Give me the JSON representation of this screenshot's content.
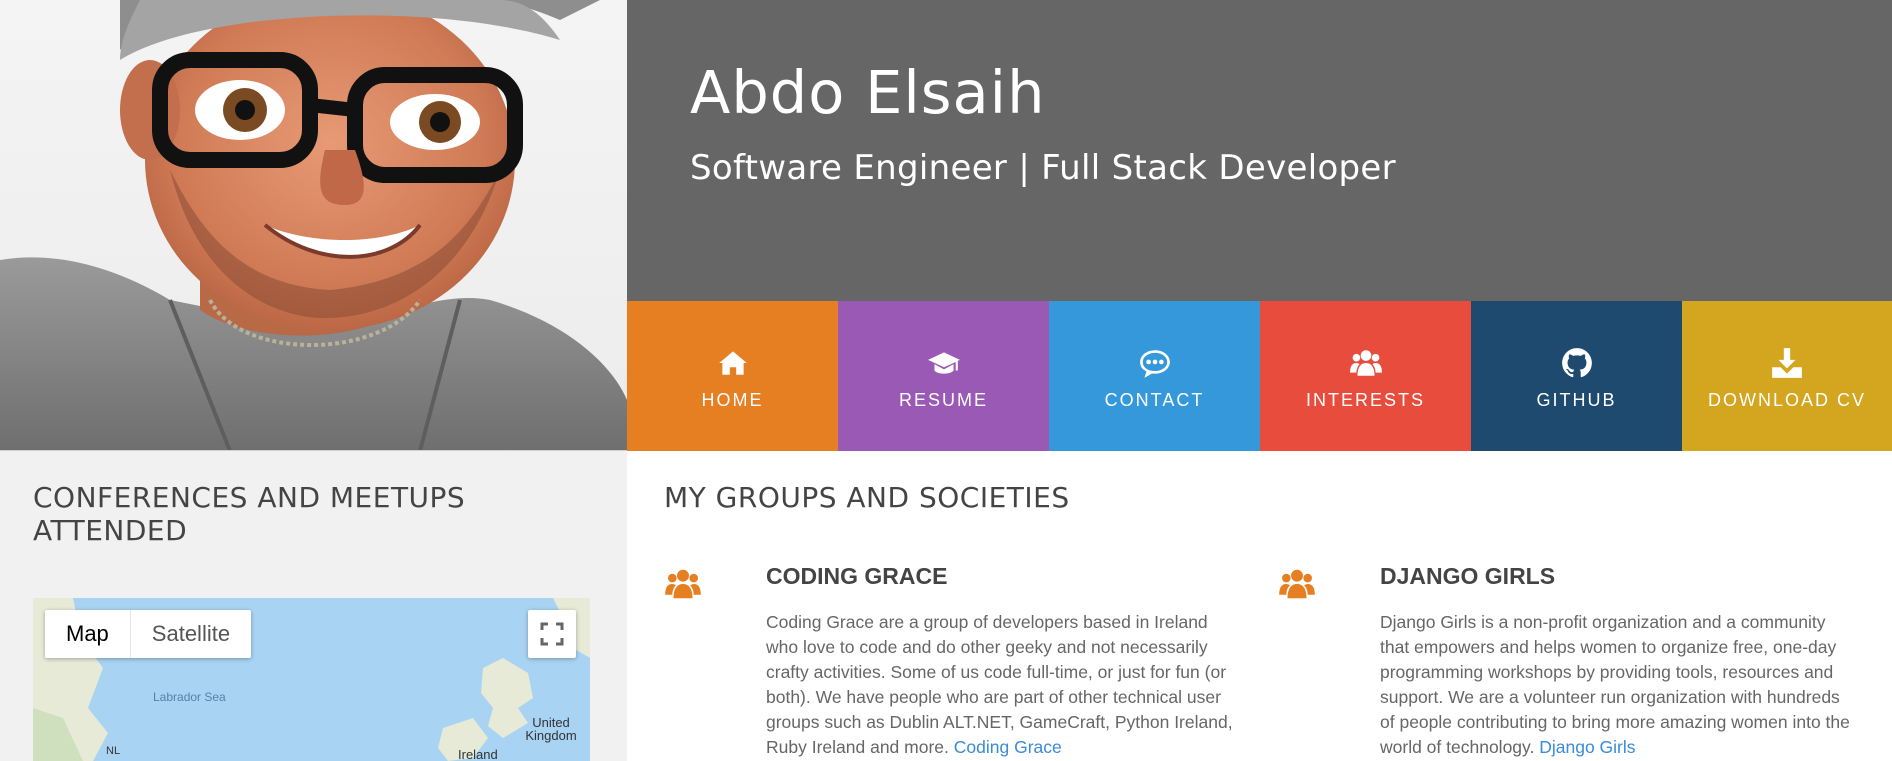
{
  "header": {
    "name": "Abdo Elsaih",
    "tagline": "Software Engineer | Full Stack Developer"
  },
  "nav": [
    {
      "label": "HOME",
      "icon": "home-icon",
      "color": "#e67e22"
    },
    {
      "label": "RESUME",
      "icon": "graduation-cap-icon",
      "color": "#9b59b6"
    },
    {
      "label": "CONTACT",
      "icon": "chat-bubble-icon",
      "color": "#3498db"
    },
    {
      "label": "INTERESTS",
      "icon": "users-icon",
      "color": "#e74c3c"
    },
    {
      "label": "GITHUB",
      "icon": "github-icon",
      "color": "#1d4a6e"
    },
    {
      "label": "DOWNLOAD CV",
      "icon": "download-icon",
      "color": "#d4a51f"
    }
  ],
  "conferences": {
    "title": "CONFERENCES AND MEETUPS ATTENDED",
    "map": {
      "map_label": "Map",
      "satellite_label": "Satellite",
      "labels": [
        "Labrador Sea",
        "United Kingdom",
        "NL",
        "Ireland"
      ]
    }
  },
  "groups": {
    "title": "MY GROUPS AND SOCIETIES",
    "items": [
      {
        "name": "CODING GRACE",
        "icon": "users-icon",
        "description": "Coding Grace are a group of developers based in Ireland who love to code and do other geeky and not necessarily crafty activities. Some of us code full-time, or just for fun (or both). We have people who are part of other technical user groups such as Dublin ALT.NET, GameCraft, Python Ireland, Ruby Ireland and more.",
        "link": "Coding Grace"
      },
      {
        "name": "DJANGO GIRLS",
        "icon": "users-icon",
        "description": "Django Girls is a non-profit organization and a community that empowers and helps women to organize free, one-day programming workshops by providing tools, resources and support. We are a volunteer run organization with hundreds of people contributing to bring more amazing women into the world of technology.",
        "link": "Django Girls"
      }
    ]
  }
}
